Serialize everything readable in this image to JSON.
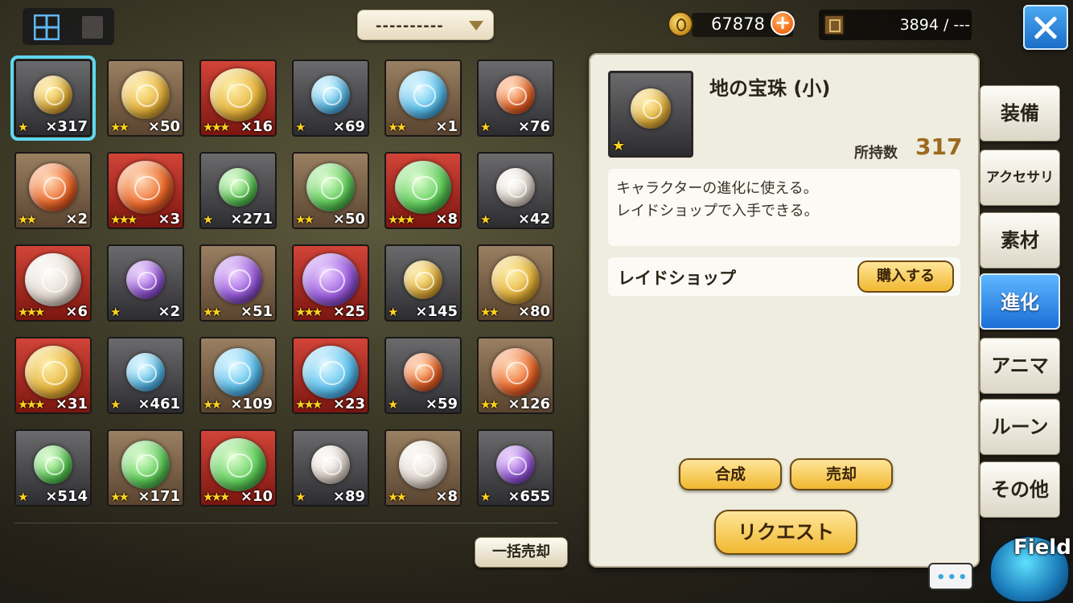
{
  "header": {
    "filter_label": "----------",
    "gold": "67878",
    "gold_plus": "+",
    "inventory": "3894 / ---"
  },
  "colors": {
    "selected_outline": "#5fd7f2",
    "active_tab": "#1a6fd6",
    "price_color": "#9c6a1e",
    "button_gold": "#f0b830"
  },
  "items": [
    {
      "element": "earth",
      "rarity": 1,
      "stars": "★",
      "count": "×317",
      "selected": true
    },
    {
      "element": "earth",
      "rarity": 2,
      "stars": "★★",
      "count": "×50"
    },
    {
      "element": "earth",
      "rarity": 3,
      "stars": "★★★",
      "count": "×16"
    },
    {
      "element": "water",
      "rarity": 1,
      "stars": "★",
      "count": "×69"
    },
    {
      "element": "water",
      "rarity": 2,
      "stars": "★★",
      "count": "×1"
    },
    {
      "element": "fire",
      "rarity": 1,
      "stars": "★",
      "count": "×76"
    },
    {
      "element": "fire",
      "rarity": 2,
      "stars": "★★",
      "count": "×2"
    },
    {
      "element": "fire",
      "rarity": 3,
      "stars": "★★★",
      "count": "×3"
    },
    {
      "element": "wind",
      "rarity": 1,
      "stars": "★",
      "count": "×271"
    },
    {
      "element": "wind",
      "rarity": 2,
      "stars": "★★",
      "count": "×50"
    },
    {
      "element": "wind",
      "rarity": 3,
      "stars": "★★★",
      "count": "×8"
    },
    {
      "element": "light",
      "rarity": 1,
      "stars": "★",
      "count": "×42"
    },
    {
      "element": "light",
      "rarity": 3,
      "stars": "★★★",
      "count": "×6"
    },
    {
      "element": "dark",
      "rarity": 1,
      "stars": "★",
      "count": "×2"
    },
    {
      "element": "dark",
      "rarity": 2,
      "stars": "★★",
      "count": "×51"
    },
    {
      "element": "dark",
      "rarity": 3,
      "stars": "★★★",
      "count": "×25"
    },
    {
      "element": "earth",
      "rarity": 1,
      "stars": "★",
      "count": "×145"
    },
    {
      "element": "earth",
      "rarity": 2,
      "stars": "★★",
      "count": "×80"
    },
    {
      "element": "earth",
      "rarity": 3,
      "stars": "★★★",
      "count": "×31"
    },
    {
      "element": "water",
      "rarity": 1,
      "stars": "★",
      "count": "×461"
    },
    {
      "element": "water",
      "rarity": 2,
      "stars": "★★",
      "count": "×109"
    },
    {
      "element": "water",
      "rarity": 3,
      "stars": "★★★",
      "count": "×23"
    },
    {
      "element": "fire",
      "rarity": 1,
      "stars": "★",
      "count": "×59"
    },
    {
      "element": "fire",
      "rarity": 2,
      "stars": "★★",
      "count": "×126"
    },
    {
      "element": "wind",
      "rarity": 1,
      "stars": "★",
      "count": "×514"
    },
    {
      "element": "wind",
      "rarity": 2,
      "stars": "★★",
      "count": "×171"
    },
    {
      "element": "wind",
      "rarity": 3,
      "stars": "★★★",
      "count": "×10"
    },
    {
      "element": "light",
      "rarity": 1,
      "stars": "★",
      "count": "×89"
    },
    {
      "element": "light",
      "rarity": 2,
      "stars": "★★",
      "count": "×8"
    },
    {
      "element": "dark",
      "rarity": 1,
      "stars": "★",
      "count": "×655"
    }
  ],
  "bulk_sell_label": "一括売却",
  "detail": {
    "name": "地の宝珠 (小)",
    "stars": "★",
    "owned_label": "所持数",
    "owned_value": "317",
    "description": [
      "キャラクターの進化に使える。",
      "レイドショップで入手できる。"
    ],
    "source_name": "レイドショップ",
    "buy_label": "購入する",
    "synthesize_label": "合成",
    "sell_label": "売却",
    "request_label": "リクエスト"
  },
  "tabs": [
    {
      "label": "装備"
    },
    {
      "label": "アクセサリ"
    },
    {
      "label": "素材"
    },
    {
      "label": "進化",
      "active": true
    },
    {
      "label": "アニマ"
    },
    {
      "label": "ルーン"
    },
    {
      "label": "その他"
    }
  ],
  "chat_dots": "•••",
  "field_label": "Field"
}
